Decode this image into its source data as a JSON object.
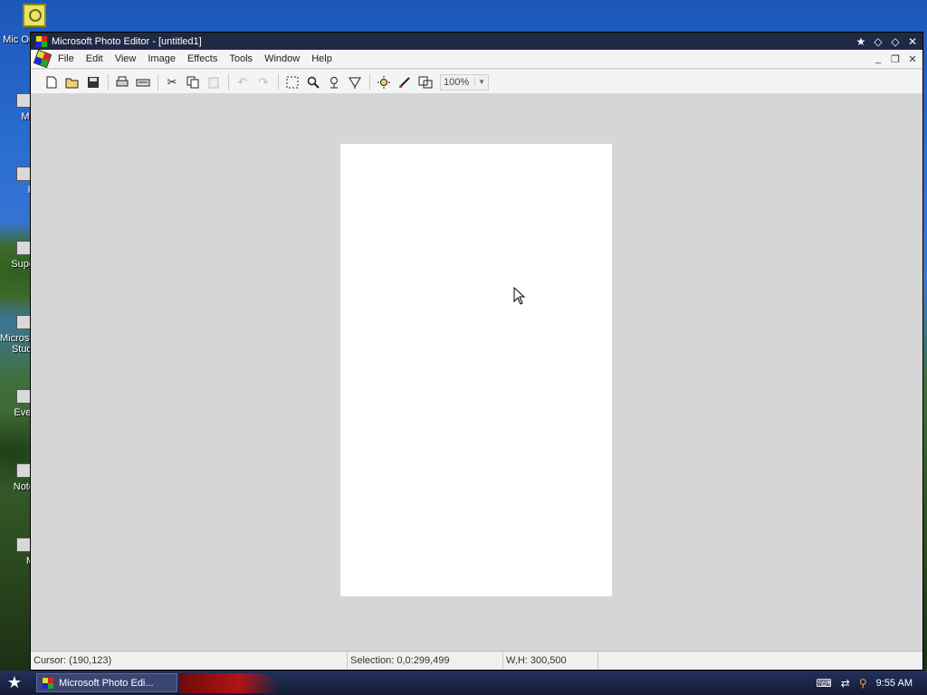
{
  "desktop": {
    "icons": [
      {
        "label": "Mic Ou"
      },
      {
        "label": "My"
      },
      {
        "label": "P"
      },
      {
        "label": "Supe"
      },
      {
        "label": "Microso Studi"
      },
      {
        "label": "Ever"
      },
      {
        "label": "Note"
      },
      {
        "label": "M"
      }
    ]
  },
  "window": {
    "title": "Microsoft Photo Editor - [untitled1]",
    "menu": [
      "File",
      "Edit",
      "View",
      "Image",
      "Effects",
      "Tools",
      "Window",
      "Help"
    ],
    "toolbar": {
      "zoom_value": "100%"
    },
    "status": {
      "cursor": "Cursor: (190,123)",
      "selection": "Selection: 0,0:299,499",
      "size": "W,H: 300,500"
    }
  },
  "taskbar": {
    "task_label": "Microsoft Photo Edi...",
    "clock": "9:55 AM"
  },
  "colors": {
    "titlebar": "#1e2a44",
    "workspace": "#d6d6d6",
    "canvas": "#ffffff"
  }
}
